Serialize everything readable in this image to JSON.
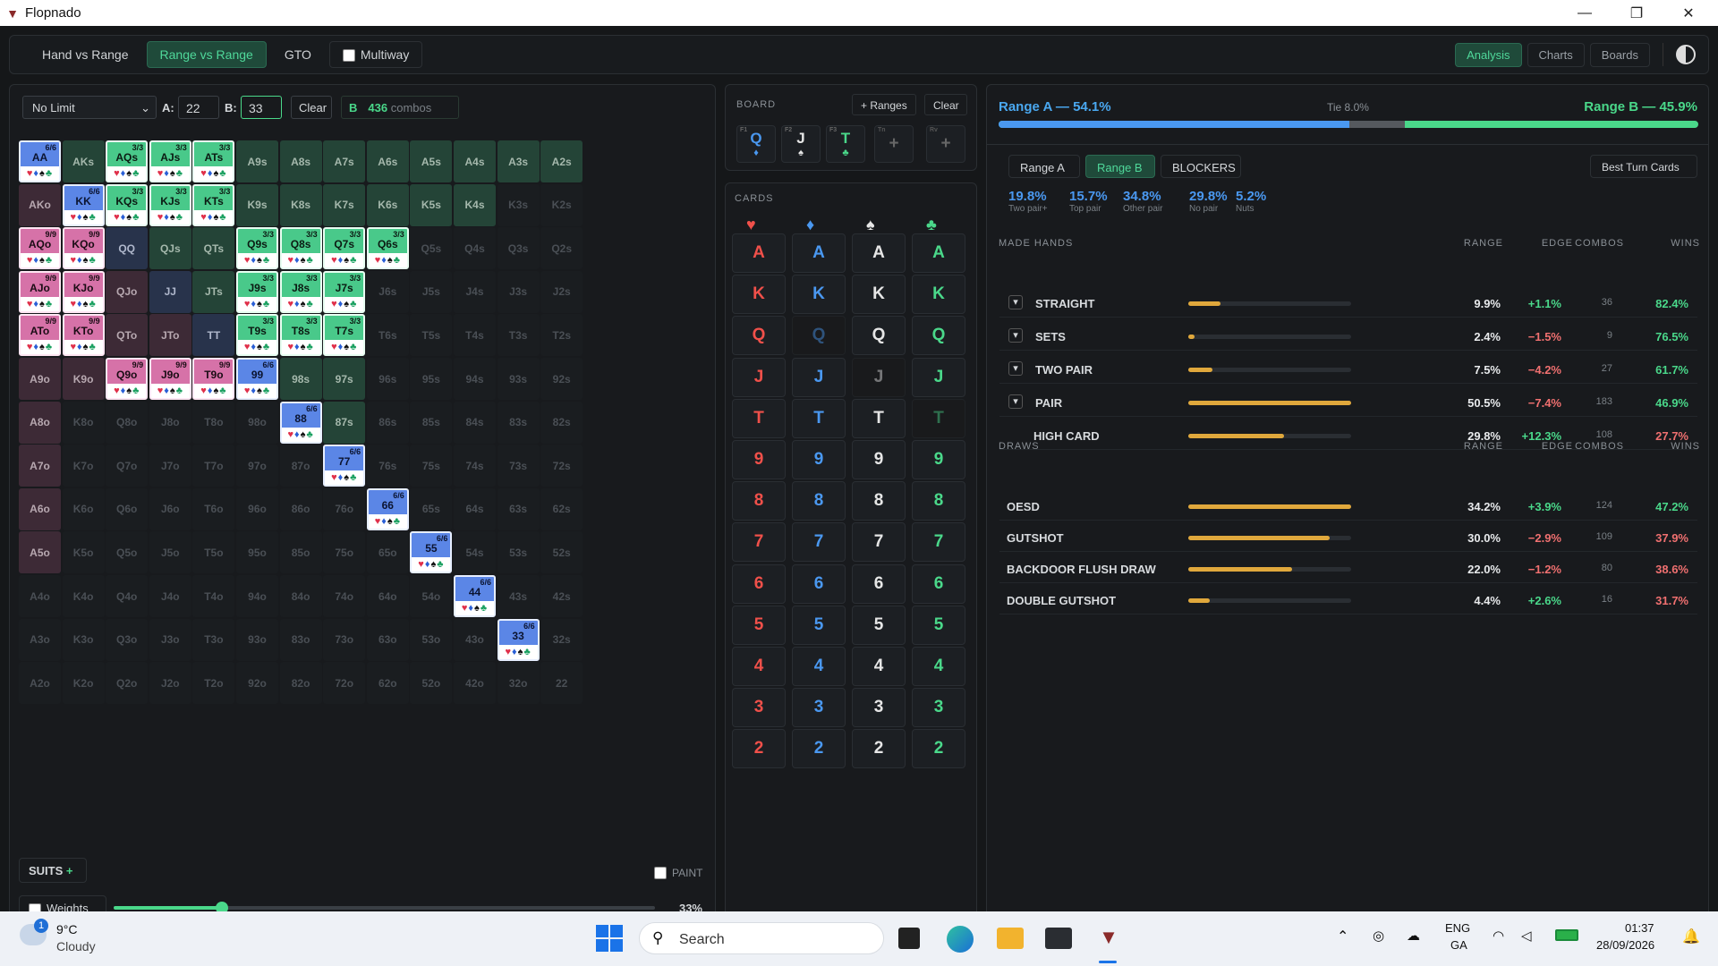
{
  "window": {
    "title": "Flopnado"
  },
  "topbar": {
    "tabs": [
      {
        "label": "Hand vs Range"
      },
      {
        "label": "Range vs Range"
      },
      {
        "label": "GTO"
      }
    ],
    "multiway": "Multiway",
    "right": [
      "Analysis",
      "Charts",
      "Boards"
    ]
  },
  "controls": {
    "game": "No Limit",
    "a_label": "A:",
    "a_value": "22",
    "b_label": "B:",
    "b_value": "33",
    "clear": "Clear",
    "b_badge": "B",
    "combos_num": "436",
    "combos_label": "combos"
  },
  "grid": {
    "cells": [
      [
        "AA",
        "AKs",
        "AQs",
        "AJs",
        "ATs",
        "A9s",
        "A8s",
        "A7s",
        "A6s",
        "A5s",
        "A4s",
        "A3s",
        "A2s"
      ],
      [
        "AKo",
        "KK",
        "KQs",
        "KJs",
        "KTs",
        "K9s",
        "K8s",
        "K7s",
        "K6s",
        "K5s",
        "K4s",
        "K3s",
        "K2s"
      ],
      [
        "AQo",
        "KQo",
        "QQ",
        "QJs",
        "QTs",
        "Q9s",
        "Q8s",
        "Q7s",
        "Q6s",
        "Q5s",
        "Q4s",
        "Q3s",
        "Q2s"
      ],
      [
        "AJo",
        "KJo",
        "QJo",
        "JJ",
        "JTs",
        "J9s",
        "J8s",
        "J7s",
        "J6s",
        "J5s",
        "J4s",
        "J3s",
        "J2s"
      ],
      [
        "ATo",
        "KTo",
        "QTo",
        "JTo",
        "TT",
        "T9s",
        "T8s",
        "T7s",
        "T6s",
        "T5s",
        "T4s",
        "T3s",
        "T2s"
      ],
      [
        "A9o",
        "K9o",
        "Q9o",
        "J9o",
        "T9o",
        "99",
        "98s",
        "97s",
        "96s",
        "95s",
        "94s",
        "93s",
        "92s"
      ],
      [
        "A8o",
        "K8o",
        "Q8o",
        "J8o",
        "T8o",
        "98o",
        "88",
        "87s",
        "86s",
        "85s",
        "84s",
        "83s",
        "82s"
      ],
      [
        "A7o",
        "K7o",
        "Q7o",
        "J7o",
        "T7o",
        "97o",
        "87o",
        "77",
        "76s",
        "75s",
        "74s",
        "73s",
        "72s"
      ],
      [
        "A6o",
        "K6o",
        "Q6o",
        "J6o",
        "T6o",
        "96o",
        "86o",
        "76o",
        "66",
        "65s",
        "64s",
        "63s",
        "62s"
      ],
      [
        "A5o",
        "K5o",
        "Q5o",
        "J5o",
        "T5o",
        "95o",
        "85o",
        "75o",
        "65o",
        "55",
        "54s",
        "53s",
        "52s"
      ],
      [
        "A4o",
        "K4o",
        "Q4o",
        "J4o",
        "T4o",
        "94o",
        "84o",
        "74o",
        "64o",
        "54o",
        "44",
        "43s",
        "42s"
      ],
      [
        "A3o",
        "K3o",
        "Q3o",
        "J3o",
        "T3o",
        "93o",
        "83o",
        "73o",
        "63o",
        "53o",
        "43o",
        "33",
        "32s"
      ],
      [
        "A2o",
        "K2o",
        "Q2o",
        "J2o",
        "T2o",
        "92o",
        "82o",
        "72o",
        "62o",
        "52o",
        "42o",
        "32o",
        "22"
      ]
    ],
    "counts": {
      "AA": "6/6",
      "AQs": "3/3",
      "AJs": "3/3",
      "ATs": "3/3",
      "KK": "6/6",
      "KQs": "3/3",
      "KJs": "3/3",
      "KTs": "3/3",
      "AQo": "9/9",
      "KQo": "9/9",
      "Q9s": "3/3",
      "Q8s": "3/3",
      "Q7s": "3/3",
      "Q6s": "3/3",
      "AJo": "9/9",
      "KJo": "9/9",
      "J9s": "3/3",
      "J8s": "3/3",
      "J7s": "3/3",
      "ATo": "9/9",
      "KTo": "9/9",
      "T9s": "3/3",
      "T8s": "3/3",
      "T7s": "3/3",
      "Q9o": "9/9",
      "J9o": "9/9",
      "T9o": "9/9",
      "99": "6/6",
      "88": "6/6",
      "77": "6/6",
      "66": "6/6",
      "55": "6/6",
      "44": "6/6",
      "33": "6/6"
    }
  },
  "suits_btn": "SUITS",
  "paint": "PAINT",
  "weights": {
    "label": "Weights",
    "value": "33%",
    "fraction": 0.33
  },
  "board": {
    "title": "BOARD",
    "ranges_btn": "+ Ranges",
    "clear": "Clear",
    "cards": [
      {
        "r": "Q",
        "s": "♦",
        "slot": "F1"
      },
      {
        "r": "J",
        "s": "♠",
        "slot": "F2"
      },
      {
        "r": "T",
        "s": "♣",
        "slot": "F3"
      }
    ],
    "empty": [
      "+",
      "+"
    ],
    "empty_slots": [
      "Tn",
      "Rv"
    ]
  },
  "cards": {
    "title": "CARDS",
    "ranks": [
      "A",
      "K",
      "Q",
      "J",
      "T",
      "9",
      "8",
      "7",
      "6",
      "5",
      "4",
      "3",
      "2"
    ]
  },
  "equity": {
    "a": "Range A — 54.1%",
    "tie": "Tie 8.0%",
    "b": "Range B — 45.9%",
    "a_frac": 0.541,
    "tie_frac": 0.08
  },
  "analysis": {
    "tabs": [
      "Range A",
      "Range B",
      "BLOCKERS"
    ],
    "best": "Best Turn Cards",
    "stats": [
      {
        "v": "19.8%",
        "l": "Two pair+"
      },
      {
        "v": "15.7%",
        "l": "Top pair"
      },
      {
        "v": "34.8%",
        "l": "Other pair"
      },
      {
        "v": "29.8%",
        "l": "No pair"
      },
      {
        "v": "5.2%",
        "l": "Nuts"
      }
    ],
    "made_title": "MADE HANDS",
    "cols": [
      "RANGE",
      "EDGE",
      "COMBOS",
      "WINS"
    ],
    "made": [
      {
        "n": "STRAIGHT",
        "r": "9.9%",
        "e": "+1.1%",
        "c": "36",
        "w": "82.4%",
        "f": 0.2
      },
      {
        "n": "SETS",
        "r": "2.4%",
        "e": "−1.5%",
        "c": "9",
        "w": "76.5%",
        "f": 0.04
      },
      {
        "n": "TWO PAIR",
        "r": "7.5%",
        "e": "−4.2%",
        "c": "27",
        "w": "61.7%",
        "f": 0.15
      },
      {
        "n": "PAIR",
        "r": "50.5%",
        "e": "−7.4%",
        "c": "183",
        "w": "46.9%",
        "f": 1.0
      },
      {
        "n": "HIGH CARD",
        "r": "29.8%",
        "e": "+12.3%",
        "c": "108",
        "w": "27.7%",
        "f": 0.59
      }
    ],
    "draws_title": "DRAWS",
    "draws": [
      {
        "n": "OESD",
        "r": "34.2%",
        "e": "+3.9%",
        "c": "124",
        "w": "47.2%",
        "f": 1.0
      },
      {
        "n": "GUTSHOT",
        "r": "30.0%",
        "e": "−2.9%",
        "c": "109",
        "w": "37.9%",
        "f": 0.87
      },
      {
        "n": "BACKDOOR FLUSH DRAW",
        "r": "22.0%",
        "e": "−1.2%",
        "c": "80",
        "w": "38.6%",
        "f": 0.64
      },
      {
        "n": "DOUBLE GUTSHOT",
        "r": "4.4%",
        "e": "+2.6%",
        "c": "16",
        "w": "31.7%",
        "f": 0.13
      }
    ]
  },
  "taskbar": {
    "temp": "9°C",
    "weather": "Cloudy",
    "search": "Search",
    "lang1": "ENG",
    "lang2": "GA",
    "time": "01:37",
    "date": "28/09/2026",
    "badge": "1"
  }
}
